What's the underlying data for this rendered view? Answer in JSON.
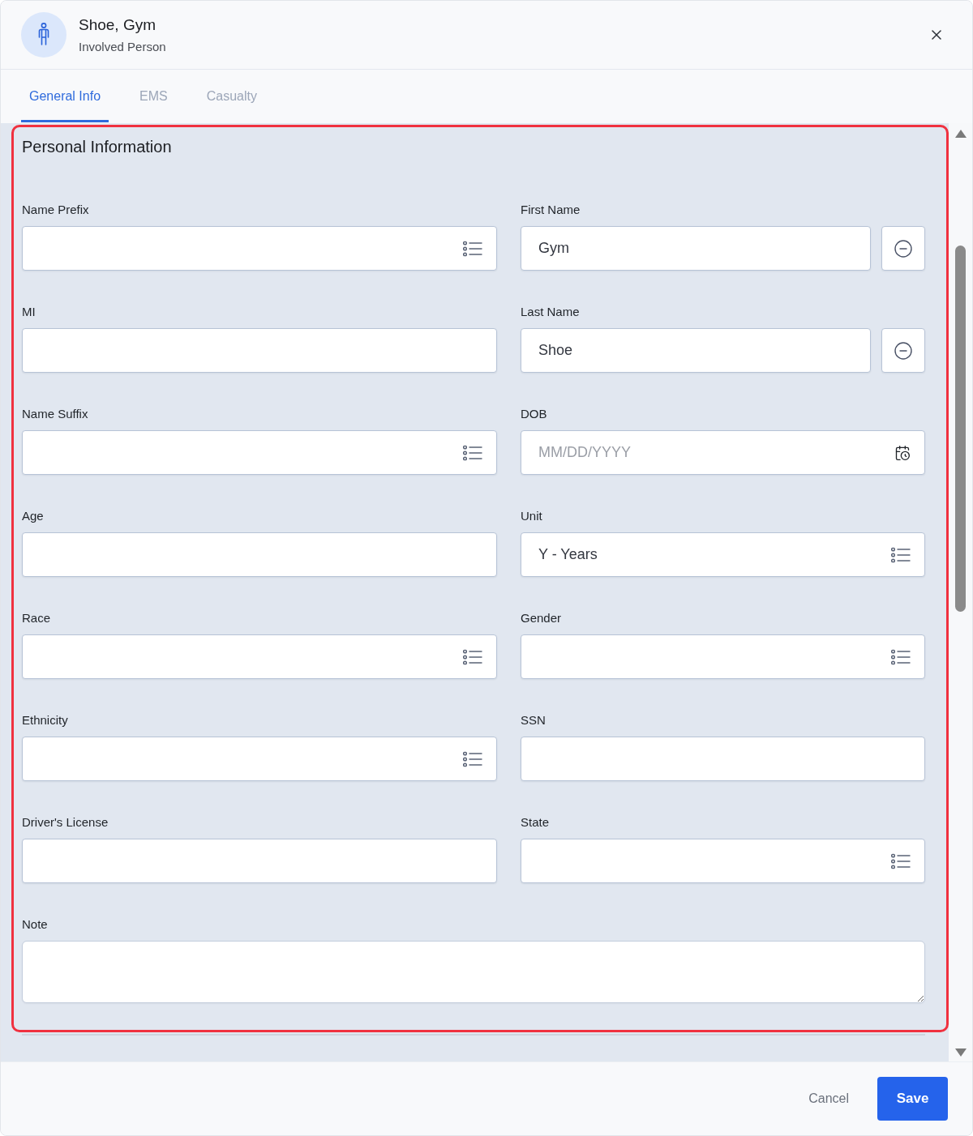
{
  "header": {
    "title": "Shoe, Gym",
    "subtitle": "Involved Person"
  },
  "tabs": [
    {
      "label": "General Info",
      "selected": true
    },
    {
      "label": "EMS",
      "selected": false
    },
    {
      "label": "Casualty",
      "selected": false
    }
  ],
  "section": {
    "title": "Personal Information",
    "highlighted": true,
    "fields": [
      {
        "label": "Name Prefix",
        "kind": "select"
      },
      {
        "label": "First Name",
        "kind": "text_action",
        "value": "Gym"
      },
      {
        "label": "MI",
        "kind": "text"
      },
      {
        "label": "Last Name",
        "kind": "text_action",
        "value": "Shoe"
      },
      {
        "label": "Name Suffix",
        "kind": "select"
      },
      {
        "label": "DOB",
        "kind": "date",
        "placeholder": "MM/DD/YYYY"
      },
      {
        "label": "Age",
        "kind": "text"
      },
      {
        "label": "Unit",
        "kind": "select",
        "value": "Y - Years"
      },
      {
        "label": "Race",
        "kind": "select"
      },
      {
        "label": "Gender",
        "kind": "select"
      },
      {
        "label": "Ethnicity",
        "kind": "select"
      },
      {
        "label": "SSN",
        "kind": "text"
      },
      {
        "label": "Driver's License",
        "kind": "text"
      },
      {
        "label": "State",
        "kind": "select"
      },
      {
        "label": "Note",
        "kind": "textarea"
      }
    ]
  },
  "footer": {
    "buttons": [
      {
        "label": "Cancel",
        "kind": "text"
      },
      {
        "label": "Save",
        "kind": "primary"
      }
    ]
  }
}
